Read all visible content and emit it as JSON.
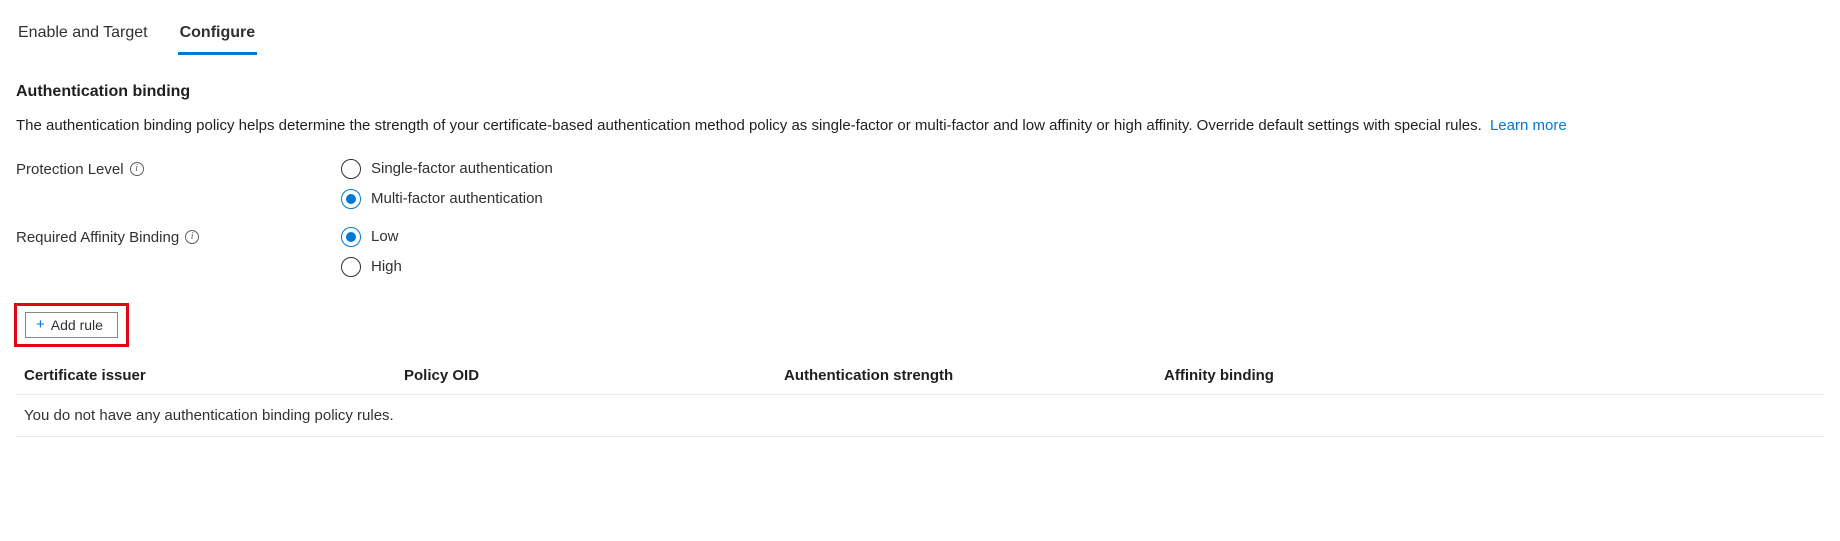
{
  "tabs": {
    "enable_target": "Enable and Target",
    "configure": "Configure"
  },
  "section": {
    "heading": "Authentication binding",
    "description": "The authentication binding policy helps determine the strength of your certificate-based authentication method policy as single-factor or multi-factor and low affinity or high affinity. Override default settings with special rules.",
    "learn_more": "Learn more"
  },
  "protection_level": {
    "label": "Protection Level",
    "options": {
      "single": "Single-factor authentication",
      "multi": "Multi-factor authentication"
    },
    "selected": "multi"
  },
  "affinity": {
    "label": "Required Affinity Binding",
    "options": {
      "low": "Low",
      "high": "High"
    },
    "selected": "low"
  },
  "add_rule": {
    "label": "Add rule"
  },
  "table": {
    "headers": {
      "issuer": "Certificate issuer",
      "oid": "Policy OID",
      "strength": "Authentication strength",
      "affinity": "Affinity binding"
    },
    "empty_message": "You do not have any authentication binding policy rules."
  }
}
